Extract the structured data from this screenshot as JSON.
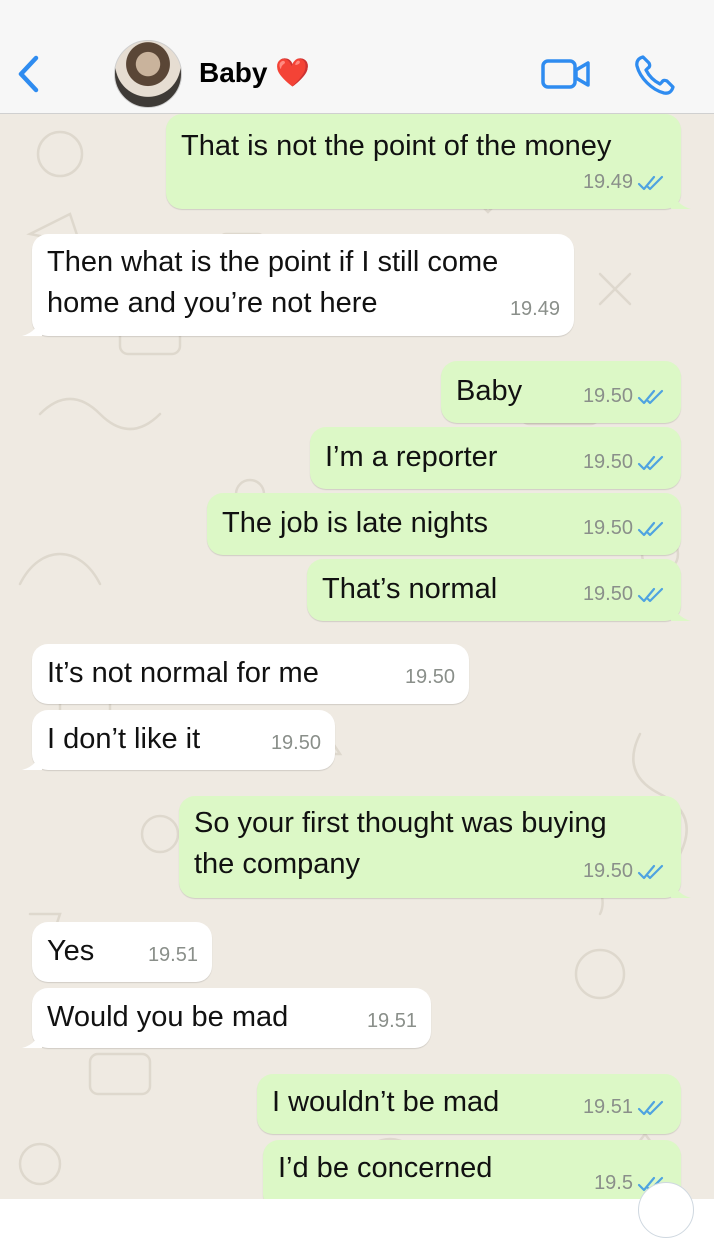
{
  "header": {
    "contact_name": "Baby",
    "heart": "❤️",
    "accent": "#2f8cf0"
  },
  "colors": {
    "incoming_bubble": "#ffffff",
    "outgoing_bubble": "#dcf8c6",
    "chat_background": "#efeae2",
    "read_tick": "#4fa3e0"
  },
  "messages": [
    {
      "dir": "out",
      "text": [
        "That is not the point of the money"
      ],
      "time": "19.49",
      "read": true
    },
    {
      "dir": "in",
      "text": [
        "Then what is the point if I still come",
        "home and you’re not here"
      ],
      "time": "19.49"
    },
    {
      "dir": "out",
      "text": [
        "Baby"
      ],
      "time": "19.50",
      "read": true
    },
    {
      "dir": "out",
      "text": [
        "I’m a reporter"
      ],
      "time": "19.50",
      "read": true
    },
    {
      "dir": "out",
      "text": [
        "The job is late nights"
      ],
      "time": "19.50",
      "read": true
    },
    {
      "dir": "out",
      "text": [
        "That’s normal"
      ],
      "time": "19.50",
      "read": true
    },
    {
      "dir": "in",
      "text": [
        "It’s not normal for me"
      ],
      "time": "19.50"
    },
    {
      "dir": "in",
      "text": [
        "I don’t like it"
      ],
      "time": "19.50"
    },
    {
      "dir": "out",
      "text": [
        "So your first thought was buying",
        "the company"
      ],
      "time": "19.50",
      "read": true
    },
    {
      "dir": "in",
      "text": [
        "Yes"
      ],
      "time": "19.51"
    },
    {
      "dir": "in",
      "text": [
        "Would you be mad"
      ],
      "time": "19.51"
    },
    {
      "dir": "out",
      "text": [
        "I wouldn’t be mad"
      ],
      "time": "19.51",
      "read": true
    },
    {
      "dir": "out",
      "text": [
        "I’d be concerned"
      ],
      "time": "19.5",
      "read": true
    }
  ]
}
